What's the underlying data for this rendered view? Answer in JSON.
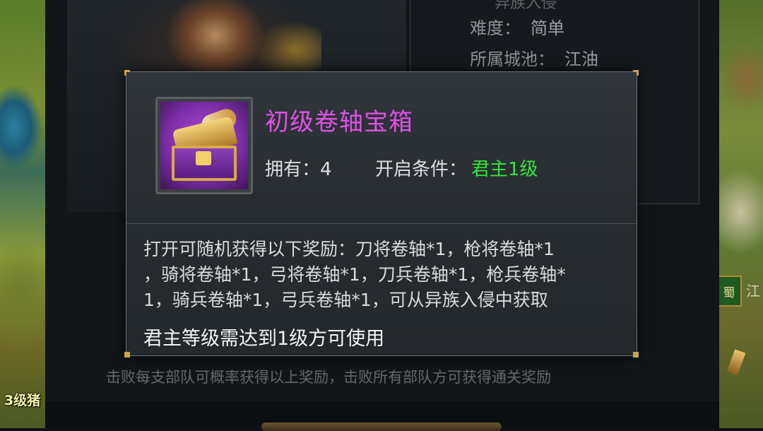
{
  "background": {
    "info_title_partial": "异族入侵",
    "difficulty_label": "难度：",
    "difficulty_value": "简单",
    "city_label": "所属城池：",
    "city_value": "江油",
    "footer_hint": "击败每支部队可概率获得以上奖励，击败所有部队方可获得通关奖励"
  },
  "map": {
    "level_badge": "3级猪",
    "faction_tag": "蜀",
    "right_glyph": "江"
  },
  "popup": {
    "item_name": "初级卷轴宝箱",
    "item_icon": "purple-treasure-chest-with-scroll",
    "own_label": "拥有：",
    "own_value": "4",
    "condition_label": "开启条件：",
    "condition_value": "君主1级",
    "description_lines": [
      "打开可随机获得以下奖励：刀将卷轴*1，枪将卷轴*1",
      "，骑将卷轴*1，弓将卷轴*1，刀兵卷轴*1，枪兵卷轴*",
      "1，骑兵卷轴*1，弓兵卷轴*1，可从异族入侵中获取"
    ],
    "requirement": "君主等级需达到1级方可使用"
  },
  "colors": {
    "item_name": "#e050e6",
    "condition_value": "#33e63a",
    "corner_accent": "#c9a24a"
  }
}
